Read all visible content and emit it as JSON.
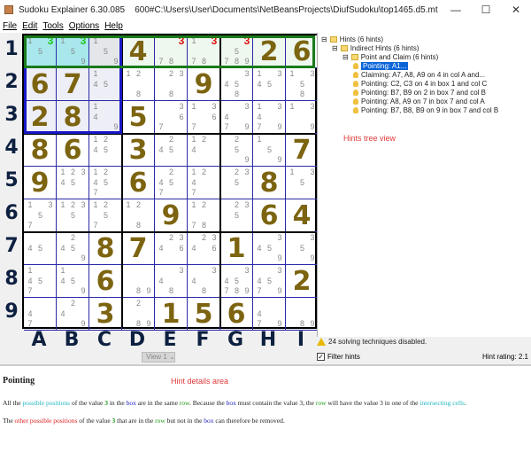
{
  "window": {
    "app": "Sudoku Explainer 6.30.085",
    "path": "600#C:\\Users\\User\\Documents\\NetBeansProjects\\DiufSudoku\\top1465.d5.mt",
    "minimize": "—",
    "maximize": "☐",
    "close": "✕"
  },
  "menu": [
    "File",
    "Edit",
    "Tools",
    "Options",
    "Help"
  ],
  "rows": [
    "1",
    "2",
    "3",
    "4",
    "5",
    "6",
    "7",
    "8",
    "9"
  ],
  "cols": [
    "A",
    "B",
    "C",
    "D",
    "E",
    "F",
    "G",
    "H",
    "I"
  ],
  "grid": [
    [
      "c135",
      "c1359",
      "c159",
      "4",
      "c378",
      "c1378",
      "c35789",
      "2",
      "6"
    ],
    [
      "6",
      "7",
      "c145",
      "c128",
      "c238",
      "9",
      "c3458",
      "c1345",
      "c1358"
    ],
    [
      "2",
      "8",
      "c149",
      "5",
      "c367",
      "c1367",
      "c3479",
      "c13479",
      "c139"
    ],
    [
      "8",
      "6",
      "c1245",
      "3",
      "c245",
      "c124",
      "c259",
      "c159",
      "7"
    ],
    [
      "9",
      "c12345",
      "c12457",
      "6",
      "c2457",
      "c1247",
      "c235",
      "8",
      "c135"
    ],
    [
      "c1357",
      "c1235",
      "c1257",
      "c128",
      "9",
      "c1278",
      "c235",
      "6",
      "4"
    ],
    [
      "c45",
      "c2459",
      "8",
      "7",
      "c2346",
      "c2346",
      "1",
      "c3459",
      "c359"
    ],
    [
      "c1457",
      "c1459",
      "6",
      "c89",
      "c348",
      "c348",
      "c345789",
      "c34579",
      "2"
    ],
    [
      "c47",
      "c249",
      "3",
      "c289",
      "1",
      "5",
      "6",
      "c479",
      "c89"
    ]
  ],
  "highlight": {
    "value": 3,
    "green_cells": [
      "A1",
      "B1"
    ],
    "red_cells": [
      "E1",
      "F1",
      "G1"
    ],
    "colors": {
      "green": "#1ec81e",
      "red": "#e01010",
      "cyan_bg": "#a8e8ec",
      "row_border": "#1a7a1a",
      "box_border": "#1818c8"
    }
  },
  "view_select": "View 1",
  "tree": {
    "root": "Hints (6 hints)",
    "group": "Indirect Hints (6 hints)",
    "sub": "Point and Claim (6 hints)",
    "items": [
      "Pointing: A1...",
      "Claiming: A7, A8, A9 on 4 in col A and...",
      "Pointing: C2, C3 on 4 in box 1 and col C",
      "Pointing: B7, B9 on 2 in box 7 and col B",
      "Pointing: A8, A9 on 7 in box 7 and col A",
      "Pointing: B7, B8, B9 on 9 in box 7 and col B"
    ]
  },
  "tree_annotation": "Hints tree view",
  "status": "24 solving techniques disabled.",
  "filter_label": "Filter hints",
  "filter_checked": true,
  "hint_rating": "Hint rating:  2.1",
  "details": {
    "title": "Pointing",
    "annotation": "Hint details area",
    "p1": [
      "All the ",
      "possible positions",
      " of the value ",
      "3",
      " in the ",
      "box",
      " are in the same ",
      "row",
      ". Because the ",
      "box",
      " must contain the value 3, the ",
      "row",
      " will have the value 3 in one of the ",
      "intersecting cells",
      "."
    ],
    "p2": [
      "The ",
      "other possible positions",
      " of the value ",
      "3",
      " that are in the ",
      "row",
      " but not in the ",
      "box",
      " can therefore be removed."
    ]
  }
}
